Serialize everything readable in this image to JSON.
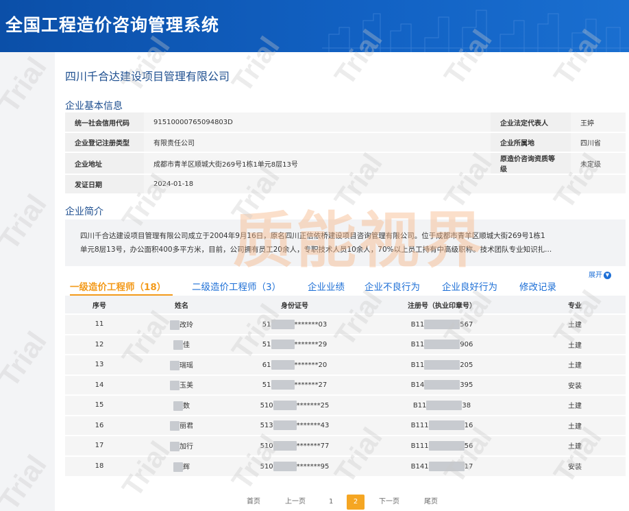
{
  "header": {
    "system_title": "全国工程造价咨询管理系统"
  },
  "company": {
    "name": "四川千合达建设项目管理有限公司"
  },
  "basic_info": {
    "section_title": "企业基本信息",
    "credit_code_label": "统一社会信用代码",
    "credit_code_value": "91510000765094803D",
    "legal_rep_label": "企业法定代表人",
    "legal_rep_value": "王婷",
    "reg_type_label": "企业登记注册类型",
    "reg_type_value": "有限责任公司",
    "location_label": "企业所属地",
    "location_value": "四川省",
    "address_label": "企业地址",
    "address_value": "成都市青羊区顺城大街269号1栋1单元8层13号",
    "qual_label": "原造价咨询资质等级",
    "qual_value": "未定级",
    "issue_date_label": "发证日期",
    "issue_date_value": "2024-01-18"
  },
  "intro": {
    "section_title": "企业简介",
    "line1": "四川千合达建设项目管理有限公司成立于2004年9月16日，原名四川正信依桥建设项目咨询管理有限公司。位于成都市青羊区顺城大街269号1栋1",
    "line2": "单元8层13号，办公面积400多平方米，目前，公司拥有员工20余人，专职技术人员10余人，70%以上员工持有中高级职称。技术团队专业知识扎...",
    "expand_label": "展开"
  },
  "tabs": [
    {
      "label": "一级造价工程师（18）"
    },
    {
      "label": "二级造价工程师（3）"
    },
    {
      "label": "企业业绩"
    },
    {
      "label": "企业不良行为"
    },
    {
      "label": "企业良好行为"
    },
    {
      "label": "修改记录"
    }
  ],
  "table": {
    "headers": [
      "序号",
      "姓名",
      "身份证号",
      "注册号（执业印章号）",
      "专业"
    ],
    "rows": [
      {
        "no": "11",
        "name": "改玲",
        "id_pre": "51",
        "id_suf": "*******03",
        "reg_pre": "B11",
        "reg_suf": "567",
        "major": "土建"
      },
      {
        "no": "12",
        "name": "佳",
        "id_pre": "51",
        "id_suf": "*******29",
        "reg_pre": "B11",
        "reg_suf": "906",
        "major": "土建"
      },
      {
        "no": "13",
        "name": "瑞瑶",
        "id_pre": "61",
        "id_suf": "*******20",
        "reg_pre": "B11",
        "reg_suf": "205",
        "major": "土建"
      },
      {
        "no": "14",
        "name": "玉美",
        "id_pre": "51",
        "id_suf": "*******27",
        "reg_pre": "B14",
        "reg_suf": "395",
        "major": "安装"
      },
      {
        "no": "15",
        "name": "数",
        "id_pre": "510",
        "id_suf": "*******25",
        "reg_pre": "B11",
        "reg_suf": "38",
        "major": "土建"
      },
      {
        "no": "16",
        "name": "丽君",
        "id_pre": "513",
        "id_suf": "*******43",
        "reg_pre": "B111",
        "reg_suf": "16",
        "major": "土建"
      },
      {
        "no": "17",
        "name": "加行",
        "id_pre": "510",
        "id_suf": "*******77",
        "reg_pre": "B111",
        "reg_suf": "56",
        "major": "土建"
      },
      {
        "no": "18",
        "name": "辉",
        "id_pre": "510",
        "id_suf": "*******95",
        "reg_pre": "B141",
        "reg_suf": "17",
        "major": "安装"
      }
    ]
  },
  "pager": {
    "first": "首页",
    "prev": "上一页",
    "page1": "1",
    "page2": "2",
    "next": "下一页",
    "last": "尾页"
  },
  "watermarks": {
    "brand": "质能视界",
    "trial": "Trial"
  }
}
